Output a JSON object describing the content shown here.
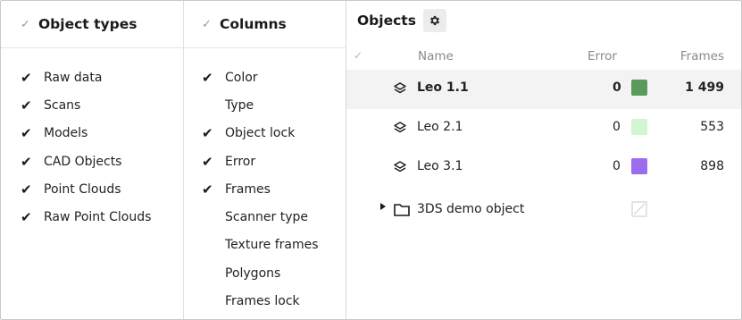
{
  "object_types": {
    "title": "Object types",
    "items": [
      {
        "label": "Raw data",
        "checked": true
      },
      {
        "label": "Scans",
        "checked": true
      },
      {
        "label": "Models",
        "checked": true
      },
      {
        "label": "CAD Objects",
        "checked": true
      },
      {
        "label": "Point Clouds",
        "checked": true
      },
      {
        "label": "Raw Point Clouds",
        "checked": true
      }
    ]
  },
  "columns": {
    "title": "Columns",
    "items": [
      {
        "label": "Color",
        "checked": true
      },
      {
        "label": "Type",
        "checked": false
      },
      {
        "label": "Object lock",
        "checked": true
      },
      {
        "label": "Error",
        "checked": true
      },
      {
        "label": "Frames",
        "checked": true
      },
      {
        "label": "Scanner type",
        "checked": false
      },
      {
        "label": "Texture frames",
        "checked": false
      },
      {
        "label": "Polygons",
        "checked": false
      },
      {
        "label": "Frames lock",
        "checked": false
      }
    ]
  },
  "objects": {
    "title": "Objects",
    "settings_icon": "gear-icon",
    "headers": {
      "name": "Name",
      "error": "Error",
      "frames": "Frames"
    },
    "rows": [
      {
        "name": "Leo 1.1",
        "error": "0",
        "color": "#5a9a5c",
        "frames": "1 499",
        "selected": true
      },
      {
        "name": "Leo 2.1",
        "error": "0",
        "color": "#d2f5d2",
        "frames": "553",
        "selected": false
      },
      {
        "name": "Leo 3.1",
        "error": "0",
        "color": "#9b6cf0",
        "frames": "898",
        "selected": false
      }
    ],
    "folder": {
      "name": "3DS demo object",
      "expanded": false
    }
  }
}
